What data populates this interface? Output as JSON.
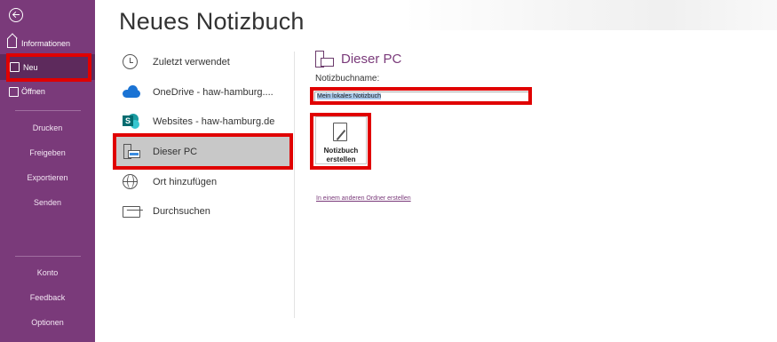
{
  "sidebar": {
    "items": [
      {
        "label": "Informationen",
        "icon": "home-icon"
      },
      {
        "label": "Neu",
        "icon": "new-doc-icon",
        "selected": true
      },
      {
        "label": "Öffnen",
        "icon": "folder-open-icon"
      }
    ],
    "plain_items": [
      "Drucken",
      "Freigeben",
      "Exportieren",
      "Senden"
    ],
    "bottom_items": [
      "Konto",
      "Feedback",
      "Optionen"
    ],
    "background": "#7a3a7a"
  },
  "header": {
    "title": "Neues Notizbuch"
  },
  "locations": [
    {
      "label": "Zuletzt verwendet",
      "icon": "clock-icon"
    },
    {
      "label": "OneDrive - haw-hamburg....",
      "icon": "onedrive-icon"
    },
    {
      "label": "Websites - haw-hamburg.de",
      "icon": "sharepoint-icon"
    },
    {
      "label": "Dieser PC",
      "icon": "pc-icon",
      "selected": true
    },
    {
      "label": "Ort hinzufügen",
      "icon": "globe-add-icon"
    },
    {
      "label": "Durchsuchen",
      "icon": "browse-folder-icon"
    }
  ],
  "pane": {
    "title": "Dieser PC",
    "field_label": "Notizbuchname:",
    "name_value": "Mein lokales Notizbuch",
    "create_button": "Notizbuch\nerstellen",
    "other_folder_link": "In einem anderen Ordner erstellen"
  },
  "colors": {
    "accent": "#7a3a7a",
    "highlight_box": "#e00000",
    "selected_item": "#c8c8c8"
  }
}
